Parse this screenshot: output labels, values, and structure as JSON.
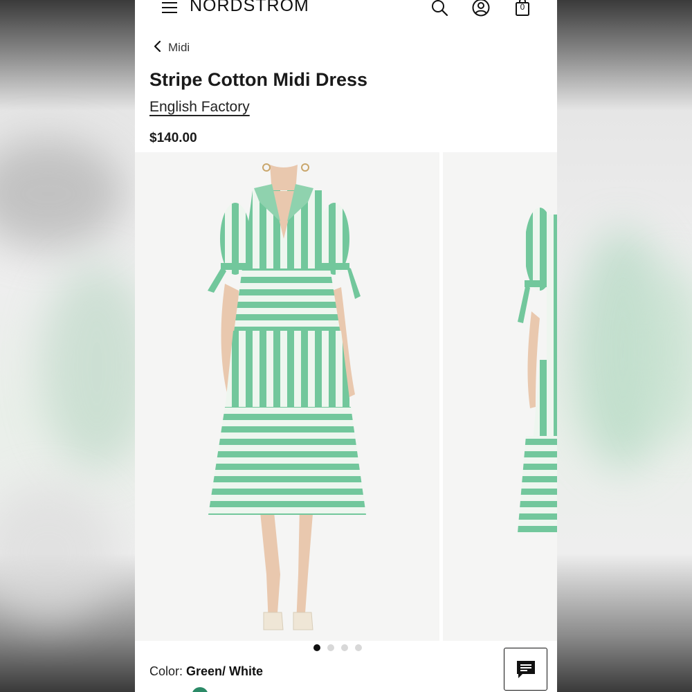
{
  "header": {
    "logo": "NORDSTROM",
    "menu_icon": "hamburger-menu-icon",
    "search_icon": "search-icon",
    "account_icon": "account-icon",
    "bag_icon": "shopping-bag-icon",
    "bag_count": "0"
  },
  "breadcrumb": {
    "back_icon": "chevron-left-icon",
    "label": "Midi"
  },
  "product": {
    "title": "Stripe Cotton Midi Dress",
    "brand": "English Factory",
    "price": "$140.00"
  },
  "gallery": {
    "image_count": 4,
    "active_index": 0
  },
  "color": {
    "label": "Color:",
    "value": "Green/ White",
    "swatch_color": "#2b8a67"
  },
  "chat": {
    "icon": "chat-icon"
  },
  "colors": {
    "stripe_green": "#72c79c",
    "stripe_white": "#eef6ef",
    "photo_bg": "#f5f5f4",
    "text": "#1a1a1a"
  }
}
